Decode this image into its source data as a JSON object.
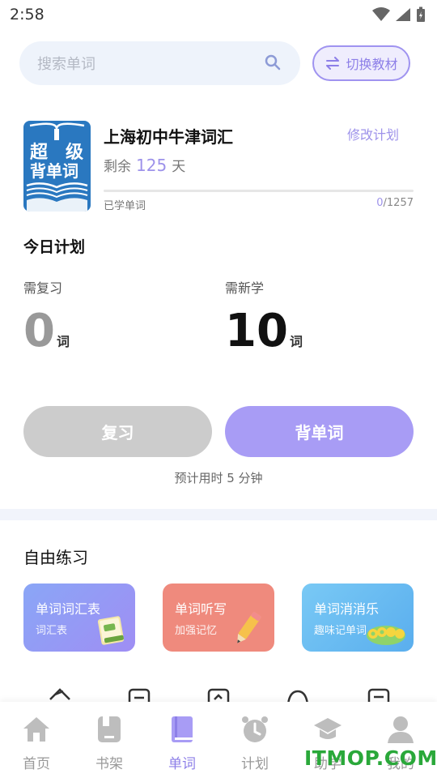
{
  "status_bar": {
    "time": "2:58"
  },
  "search": {
    "placeholder": "搜索单词"
  },
  "switch_button": {
    "label": "切换教材"
  },
  "book": {
    "cover_text": [
      "超",
      "级",
      "背单词"
    ],
    "title": "上海初中牛津词汇",
    "modify_label": "修改计划",
    "remain_prefix": "剩余",
    "remain_days": "125",
    "remain_suffix": "天",
    "learned_label": "已学单词",
    "learned": "0",
    "total": "/1257",
    "progress": 0
  },
  "today": {
    "title": "今日计划",
    "review_label": "需复习",
    "review_count": "0",
    "new_label": "需新学",
    "new_count": "10",
    "unit": "词"
  },
  "actions": {
    "review": "复习",
    "learn": "背单词",
    "estimate": "预计用时 5 分钟"
  },
  "practice": {
    "title": "自由练习",
    "cards": [
      {
        "title": "单词词汇表",
        "subtitle": "词汇表",
        "color": "#8f99f5"
      },
      {
        "title": "单词听写",
        "subtitle": "加强记忆",
        "color": "#ef8a7d"
      },
      {
        "title": "单词消消乐",
        "subtitle": "趣味记单词",
        "color": "#68c0f3"
      }
    ],
    "card_art": [
      "book-icon",
      "pencil-icon",
      "oops-badge"
    ]
  },
  "nav": {
    "items": [
      {
        "label": "首页",
        "icon": "home-icon"
      },
      {
        "label": "书架",
        "icon": "bookshelf-icon"
      },
      {
        "label": "单词",
        "icon": "book-icon"
      },
      {
        "label": "计划",
        "icon": "alarm-clock-icon"
      },
      {
        "label": "助学",
        "icon": "graduation-cap-icon"
      },
      {
        "label": "我的",
        "icon": "user-icon"
      }
    ],
    "active_index": 2
  },
  "watermark": "ITMOP.COM",
  "colors": {
    "accent": "#8d7fe8",
    "accent_light": "#a89cf5",
    "search_bg": "#eef3fb",
    "book_blue": "#2a78c0",
    "divider": "#f1f4fb"
  }
}
